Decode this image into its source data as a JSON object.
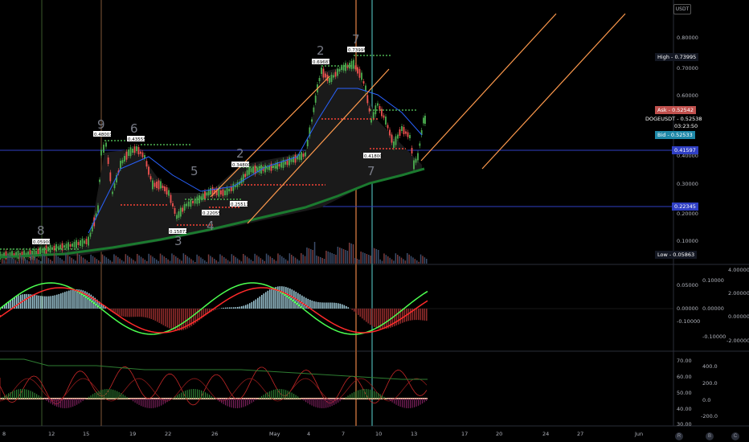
{
  "quote_currency": "USDT",
  "price_axis": {
    "ticks": [
      "0.80000",
      "0.70000",
      "0.60000",
      "0.40000",
      "0.30000",
      "0.20000",
      "0.10000"
    ],
    "high": {
      "label": "High",
      "value": "0.73995"
    },
    "ask": {
      "label": "Ask",
      "value": "0.52542"
    },
    "symbol": {
      "label": "DOGEUSDT",
      "value": "0.52538",
      "countdown": "03:23:50"
    },
    "bid": {
      "label": "Bid",
      "value": "0.52533"
    },
    "level_line_1": "0.41597",
    "level_line_2": "0.22345",
    "low": {
      "label": "Low",
      "value": "0.05863"
    }
  },
  "point_labels": [
    "0.05900",
    "0.48003",
    "0.43555",
    "0.15872",
    "0.22055",
    "0.34800",
    "0.25511",
    "0.69683",
    "0.73995",
    "0.41800"
  ],
  "wave_counts": [
    "8",
    "9",
    "6",
    "5",
    "4",
    "2",
    "3",
    "2",
    "7",
    "7"
  ],
  "macd_axis_left": [
    "0.05000",
    "0.00000",
    "-0.10000"
  ],
  "macd_axis_mid": [
    "0.10000",
    "0.00000",
    "-0.10000"
  ],
  "macd_axis_right": [
    "4.00000",
    "2.00000",
    "0.00000",
    "-2.00000"
  ],
  "osc_axis_left": [
    "70.00",
    "60.00",
    "50.00",
    "40.00",
    "30.00"
  ],
  "osc_axis_right": [
    "400.0",
    "200.0",
    "0.0",
    "-200.0"
  ],
  "time_axis": [
    "8",
    "12",
    "15",
    "19",
    "22",
    "26",
    "May",
    "4",
    "7",
    "10",
    "13",
    "17",
    "20",
    "24",
    "27",
    "Jun"
  ],
  "bottom_buttons": [
    "R",
    "B",
    "C"
  ],
  "colors": {
    "bull": "#26a69a",
    "bear": "#ef5350",
    "ma_long": "#1b7a2f",
    "ma_mid": "#2962ff",
    "channel": "#ff9a4d",
    "level": "#2f3fc4"
  }
}
